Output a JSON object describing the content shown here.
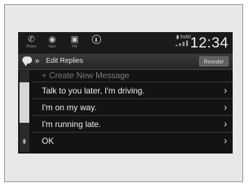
{
  "statusbar": {
    "icons": [
      {
        "name": "phone-icon",
        "glyph": "✆",
        "caption": "Phone"
      },
      {
        "name": "navi-icon",
        "glyph": "◉",
        "caption": "Navi"
      },
      {
        "name": "fm-icon",
        "glyph": "▣",
        "caption": "FM"
      },
      {
        "name": "download-icon",
        "glyph": "⬇",
        "caption": ""
      }
    ],
    "battery_text": "▮ 5s60",
    "time": "12:34"
  },
  "header": {
    "breadcrumb_chevron": "»",
    "title": "Edit Replies",
    "reorder_label": "Reorder"
  },
  "scrollbar": {
    "down_glyph": "⇟"
  },
  "list": {
    "create_label": "+ Create New Message",
    "chevron": "›",
    "items": [
      {
        "label": "Talk to you later, I'm driving."
      },
      {
        "label": "I'm on my way."
      },
      {
        "label": "I'm running late."
      },
      {
        "label": "OK"
      }
    ]
  }
}
